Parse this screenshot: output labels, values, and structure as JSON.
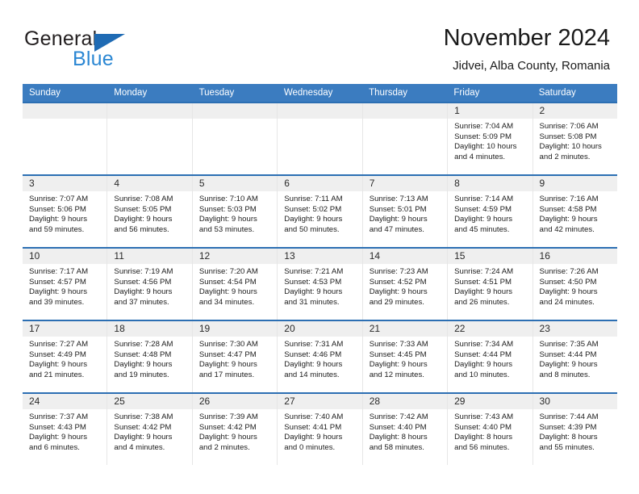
{
  "brand": {
    "name_top": "General",
    "name_bottom": "Blue",
    "triangle_color": "#1f6bb4",
    "blue_color": "#2b87d3"
  },
  "header": {
    "title": "November 2024",
    "subtitle": "Jidvei, Alba County, Romania"
  },
  "colors": {
    "header_blue": "#3b7cc0",
    "row_rule_blue": "#2c6fb3",
    "day_band_gray": "#efefef"
  },
  "weekdays": [
    "Sunday",
    "Monday",
    "Tuesday",
    "Wednesday",
    "Thursday",
    "Friday",
    "Saturday"
  ],
  "weeks": [
    [
      {
        "day": "",
        "sunrise": "",
        "sunset": "",
        "daylight_line1": "",
        "daylight_line2": ""
      },
      {
        "day": "",
        "sunrise": "",
        "sunset": "",
        "daylight_line1": "",
        "daylight_line2": ""
      },
      {
        "day": "",
        "sunrise": "",
        "sunset": "",
        "daylight_line1": "",
        "daylight_line2": ""
      },
      {
        "day": "",
        "sunrise": "",
        "sunset": "",
        "daylight_line1": "",
        "daylight_line2": ""
      },
      {
        "day": "",
        "sunrise": "",
        "sunset": "",
        "daylight_line1": "",
        "daylight_line2": ""
      },
      {
        "day": "1",
        "sunrise": "Sunrise: 7:04 AM",
        "sunset": "Sunset: 5:09 PM",
        "daylight_line1": "Daylight: 10 hours",
        "daylight_line2": "and 4 minutes."
      },
      {
        "day": "2",
        "sunrise": "Sunrise: 7:06 AM",
        "sunset": "Sunset: 5:08 PM",
        "daylight_line1": "Daylight: 10 hours",
        "daylight_line2": "and 2 minutes."
      }
    ],
    [
      {
        "day": "3",
        "sunrise": "Sunrise: 7:07 AM",
        "sunset": "Sunset: 5:06 PM",
        "daylight_line1": "Daylight: 9 hours",
        "daylight_line2": "and 59 minutes."
      },
      {
        "day": "4",
        "sunrise": "Sunrise: 7:08 AM",
        "sunset": "Sunset: 5:05 PM",
        "daylight_line1": "Daylight: 9 hours",
        "daylight_line2": "and 56 minutes."
      },
      {
        "day": "5",
        "sunrise": "Sunrise: 7:10 AM",
        "sunset": "Sunset: 5:03 PM",
        "daylight_line1": "Daylight: 9 hours",
        "daylight_line2": "and 53 minutes."
      },
      {
        "day": "6",
        "sunrise": "Sunrise: 7:11 AM",
        "sunset": "Sunset: 5:02 PM",
        "daylight_line1": "Daylight: 9 hours",
        "daylight_line2": "and 50 minutes."
      },
      {
        "day": "7",
        "sunrise": "Sunrise: 7:13 AM",
        "sunset": "Sunset: 5:01 PM",
        "daylight_line1": "Daylight: 9 hours",
        "daylight_line2": "and 47 minutes."
      },
      {
        "day": "8",
        "sunrise": "Sunrise: 7:14 AM",
        "sunset": "Sunset: 4:59 PM",
        "daylight_line1": "Daylight: 9 hours",
        "daylight_line2": "and 45 minutes."
      },
      {
        "day": "9",
        "sunrise": "Sunrise: 7:16 AM",
        "sunset": "Sunset: 4:58 PM",
        "daylight_line1": "Daylight: 9 hours",
        "daylight_line2": "and 42 minutes."
      }
    ],
    [
      {
        "day": "10",
        "sunrise": "Sunrise: 7:17 AM",
        "sunset": "Sunset: 4:57 PM",
        "daylight_line1": "Daylight: 9 hours",
        "daylight_line2": "and 39 minutes."
      },
      {
        "day": "11",
        "sunrise": "Sunrise: 7:19 AM",
        "sunset": "Sunset: 4:56 PM",
        "daylight_line1": "Daylight: 9 hours",
        "daylight_line2": "and 37 minutes."
      },
      {
        "day": "12",
        "sunrise": "Sunrise: 7:20 AM",
        "sunset": "Sunset: 4:54 PM",
        "daylight_line1": "Daylight: 9 hours",
        "daylight_line2": "and 34 minutes."
      },
      {
        "day": "13",
        "sunrise": "Sunrise: 7:21 AM",
        "sunset": "Sunset: 4:53 PM",
        "daylight_line1": "Daylight: 9 hours",
        "daylight_line2": "and 31 minutes."
      },
      {
        "day": "14",
        "sunrise": "Sunrise: 7:23 AM",
        "sunset": "Sunset: 4:52 PM",
        "daylight_line1": "Daylight: 9 hours",
        "daylight_line2": "and 29 minutes."
      },
      {
        "day": "15",
        "sunrise": "Sunrise: 7:24 AM",
        "sunset": "Sunset: 4:51 PM",
        "daylight_line1": "Daylight: 9 hours",
        "daylight_line2": "and 26 minutes."
      },
      {
        "day": "16",
        "sunrise": "Sunrise: 7:26 AM",
        "sunset": "Sunset: 4:50 PM",
        "daylight_line1": "Daylight: 9 hours",
        "daylight_line2": "and 24 minutes."
      }
    ],
    [
      {
        "day": "17",
        "sunrise": "Sunrise: 7:27 AM",
        "sunset": "Sunset: 4:49 PM",
        "daylight_line1": "Daylight: 9 hours",
        "daylight_line2": "and 21 minutes."
      },
      {
        "day": "18",
        "sunrise": "Sunrise: 7:28 AM",
        "sunset": "Sunset: 4:48 PM",
        "daylight_line1": "Daylight: 9 hours",
        "daylight_line2": "and 19 minutes."
      },
      {
        "day": "19",
        "sunrise": "Sunrise: 7:30 AM",
        "sunset": "Sunset: 4:47 PM",
        "daylight_line1": "Daylight: 9 hours",
        "daylight_line2": "and 17 minutes."
      },
      {
        "day": "20",
        "sunrise": "Sunrise: 7:31 AM",
        "sunset": "Sunset: 4:46 PM",
        "daylight_line1": "Daylight: 9 hours",
        "daylight_line2": "and 14 minutes."
      },
      {
        "day": "21",
        "sunrise": "Sunrise: 7:33 AM",
        "sunset": "Sunset: 4:45 PM",
        "daylight_line1": "Daylight: 9 hours",
        "daylight_line2": "and 12 minutes."
      },
      {
        "day": "22",
        "sunrise": "Sunrise: 7:34 AM",
        "sunset": "Sunset: 4:44 PM",
        "daylight_line1": "Daylight: 9 hours",
        "daylight_line2": "and 10 minutes."
      },
      {
        "day": "23",
        "sunrise": "Sunrise: 7:35 AM",
        "sunset": "Sunset: 4:44 PM",
        "daylight_line1": "Daylight: 9 hours",
        "daylight_line2": "and 8 minutes."
      }
    ],
    [
      {
        "day": "24",
        "sunrise": "Sunrise: 7:37 AM",
        "sunset": "Sunset: 4:43 PM",
        "daylight_line1": "Daylight: 9 hours",
        "daylight_line2": "and 6 minutes."
      },
      {
        "day": "25",
        "sunrise": "Sunrise: 7:38 AM",
        "sunset": "Sunset: 4:42 PM",
        "daylight_line1": "Daylight: 9 hours",
        "daylight_line2": "and 4 minutes."
      },
      {
        "day": "26",
        "sunrise": "Sunrise: 7:39 AM",
        "sunset": "Sunset: 4:42 PM",
        "daylight_line1": "Daylight: 9 hours",
        "daylight_line2": "and 2 minutes."
      },
      {
        "day": "27",
        "sunrise": "Sunrise: 7:40 AM",
        "sunset": "Sunset: 4:41 PM",
        "daylight_line1": "Daylight: 9 hours",
        "daylight_line2": "and 0 minutes."
      },
      {
        "day": "28",
        "sunrise": "Sunrise: 7:42 AM",
        "sunset": "Sunset: 4:40 PM",
        "daylight_line1": "Daylight: 8 hours",
        "daylight_line2": "and 58 minutes."
      },
      {
        "day": "29",
        "sunrise": "Sunrise: 7:43 AM",
        "sunset": "Sunset: 4:40 PM",
        "daylight_line1": "Daylight: 8 hours",
        "daylight_line2": "and 56 minutes."
      },
      {
        "day": "30",
        "sunrise": "Sunrise: 7:44 AM",
        "sunset": "Sunset: 4:39 PM",
        "daylight_line1": "Daylight: 8 hours",
        "daylight_line2": "and 55 minutes."
      }
    ]
  ]
}
